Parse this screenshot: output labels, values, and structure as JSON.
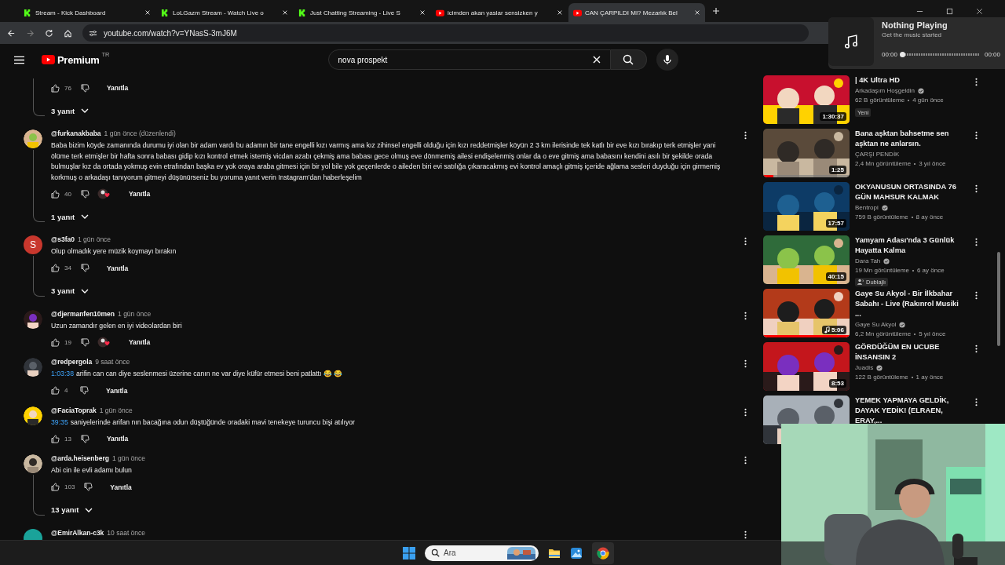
{
  "browser": {
    "tabs": [
      {
        "title": "Stream - Kick Dashboard",
        "kind": "kick",
        "selected": false
      },
      {
        "title": "LoLGazm Stream - Watch Live o",
        "kind": "kick",
        "selected": false
      },
      {
        "title": "Just Chatting Streaming - Live S",
        "kind": "kick",
        "selected": false
      },
      {
        "title": "icimden akan yaslar sensizken y",
        "kind": "youtube",
        "selected": false
      },
      {
        "title": "CAN ÇARPILDI MI? Mezarlık Bel",
        "kind": "youtube",
        "selected": true
      }
    ],
    "url": "youtube.com/watch?v=YNasS-3mJ6M"
  },
  "header": {
    "logo": "Premium",
    "region": "TR",
    "search": {
      "value": "nova prospekt"
    }
  },
  "comments": [
    {
      "likes": "76",
      "heart": false,
      "reply": "Yanıtla",
      "replies": "3 yanıt"
    },
    {
      "author": "@furkanakbaba",
      "time": "1 gün önce (düzenlendi)",
      "text": "Baba bizim köyde zamanında durumu iyi olan bir adam vardı bu adamın bir tane engelli kızı varmış ama kız zihinsel engelli olduğu için kızı reddetmişler köyün 2 3 km ilerisinde tek katlı bir eve kızı bırakıp terk etmişler yani ölüme terk etmişler bir hafta sonra babası gidip kızı kontrol etmek istemiş vicdan azabı çekmiş ama babası gece olmuş eve dönmemiş ailesi endişelenmiş onlar da o eve gitmiş ama babasını kendini asılı bir şekilde orada bulmuşlar kız da ortada yokmuş evin etrafından başka ev yok oraya araba gitmesi için bir yol bile yok geçenlerde o aileden biri evi satılığa çıkaracakmış evi kontrol amaçlı gitmiş içeride ağlama sesleri duyduğu için girmemiş korkmuş o arkadaşı tanıyorum gitmeyi düşünürseniz bu yoruma yanıt verin Instagram'dan haberleşelim",
      "likes": "40",
      "heart": true,
      "reply": "Yanıtla",
      "replies": "1 yanıt"
    },
    {
      "author": "@s3fa0",
      "time": "1 gün önce",
      "avatar": {
        "kind": "letter",
        "letter": "S",
        "color": "#c8372d"
      },
      "text": "Olup olmadık yere müzik koymayı bırakın",
      "likes": "34",
      "heart": false,
      "reply": "Yanıtla",
      "replies": "3 yanıt"
    },
    {
      "author": "@djermanfen10men",
      "time": "1 gün önce",
      "text": "Uzun zamandır gelen en iyi videolardan biri",
      "likes": "19",
      "heart": true,
      "reply": "Yanıtla"
    },
    {
      "author": "@redpergola",
      "time": "9 saat önce",
      "timestamp": "1:03:38",
      "text": "arifin can can diye seslenmesi üzerine canın ne var diye küfür etmesi beni patlattı 😂 😂",
      "likes": "4",
      "heart": false,
      "reply": "Yanıtla"
    },
    {
      "author": "@FaciaToprak",
      "time": "1 gün önce",
      "timestamp": "39:35",
      "text": "saniyelerinde arifan nın bacağına odun düştüğünde oradaki mavi tenekeye turuncu bişi atılıyor",
      "likes": "13",
      "heart": false,
      "reply": "Yanıtla"
    },
    {
      "author": "@arda.heisenberg",
      "time": "1 gün önce",
      "text": "Abi cin ile evli adamı bulun",
      "likes": "103",
      "heart": false,
      "reply": "Yanıtla",
      "replies": "13 yanıt"
    },
    {
      "author": "@EmirAlkan-c3k",
      "time": "10 saat önce",
      "avatar": {
        "kind": "letter",
        "color": "#1aa39a"
      }
    }
  ],
  "videos": [
    {
      "title": "| 4K Ultra HD",
      "channel": "Arkadaşım Hoşgeldin",
      "verified": true,
      "views": "62 B görüntüleme",
      "age": "4 gün önce",
      "badge": {
        "kind": "text",
        "label": "Yeni"
      },
      "duration": "1:30:37",
      "music": false
    },
    {
      "title": "Bana aşktan bahsetme sen aşktan ne anlarsın.",
      "channel": "ÇARŞI PENDİK",
      "verified": false,
      "views": "2,4 Mn görüntüleme",
      "age": "3 yıl önce",
      "duration": "1:25",
      "music": false,
      "level": 0.12
    },
    {
      "title": "OKYANUSUN ORTASINDA 76 GÜN MAHSUR KALMAK",
      "channel": "Bentropi",
      "verified": true,
      "views": "759 B görüntüleme",
      "age": "8 ay önce",
      "duration": "17:57",
      "music": false
    },
    {
      "title": "Yamyam Adası'nda 3 Günlük Hayatta Kalma",
      "channel": "Dara Tah",
      "verified": true,
      "views": "19 Mn görüntüleme",
      "age": "6 ay önce",
      "badge": {
        "kind": "dubbed",
        "label": "Dublajlı"
      },
      "duration": "40:15",
      "music": false
    },
    {
      "title": "Gaye Su Akyol - Bir İlkbahar Sabahı - Live (Rakınrol Musiki ...",
      "channel": "Gaye Su Akyol",
      "verified": true,
      "views": "6,2 Mn görüntüleme",
      "age": "5 yıl önce",
      "duration": "5:06",
      "music": true,
      "level": 1
    },
    {
      "title": "GÖRDÜĞÜM EN UCUBE İNSANSIN 2",
      "channel": "Juadis",
      "verified": true,
      "views": "122 B görüntüleme",
      "age": "1 ay önce",
      "duration": "8:53",
      "music": false
    },
    {
      "title": "YEMEK YAPMAYA GELDİK, DAYAK YEDİK! (ELRAEN, ERAY,...",
      "music": false
    }
  ],
  "media_widget": {
    "title": "Nothing Playing",
    "subtitle": "Get the music started",
    "elapsed": "00:00",
    "total": "00:00",
    "level": 0
  },
  "taskbar": {
    "search": {
      "placeholder": "Ara"
    }
  }
}
